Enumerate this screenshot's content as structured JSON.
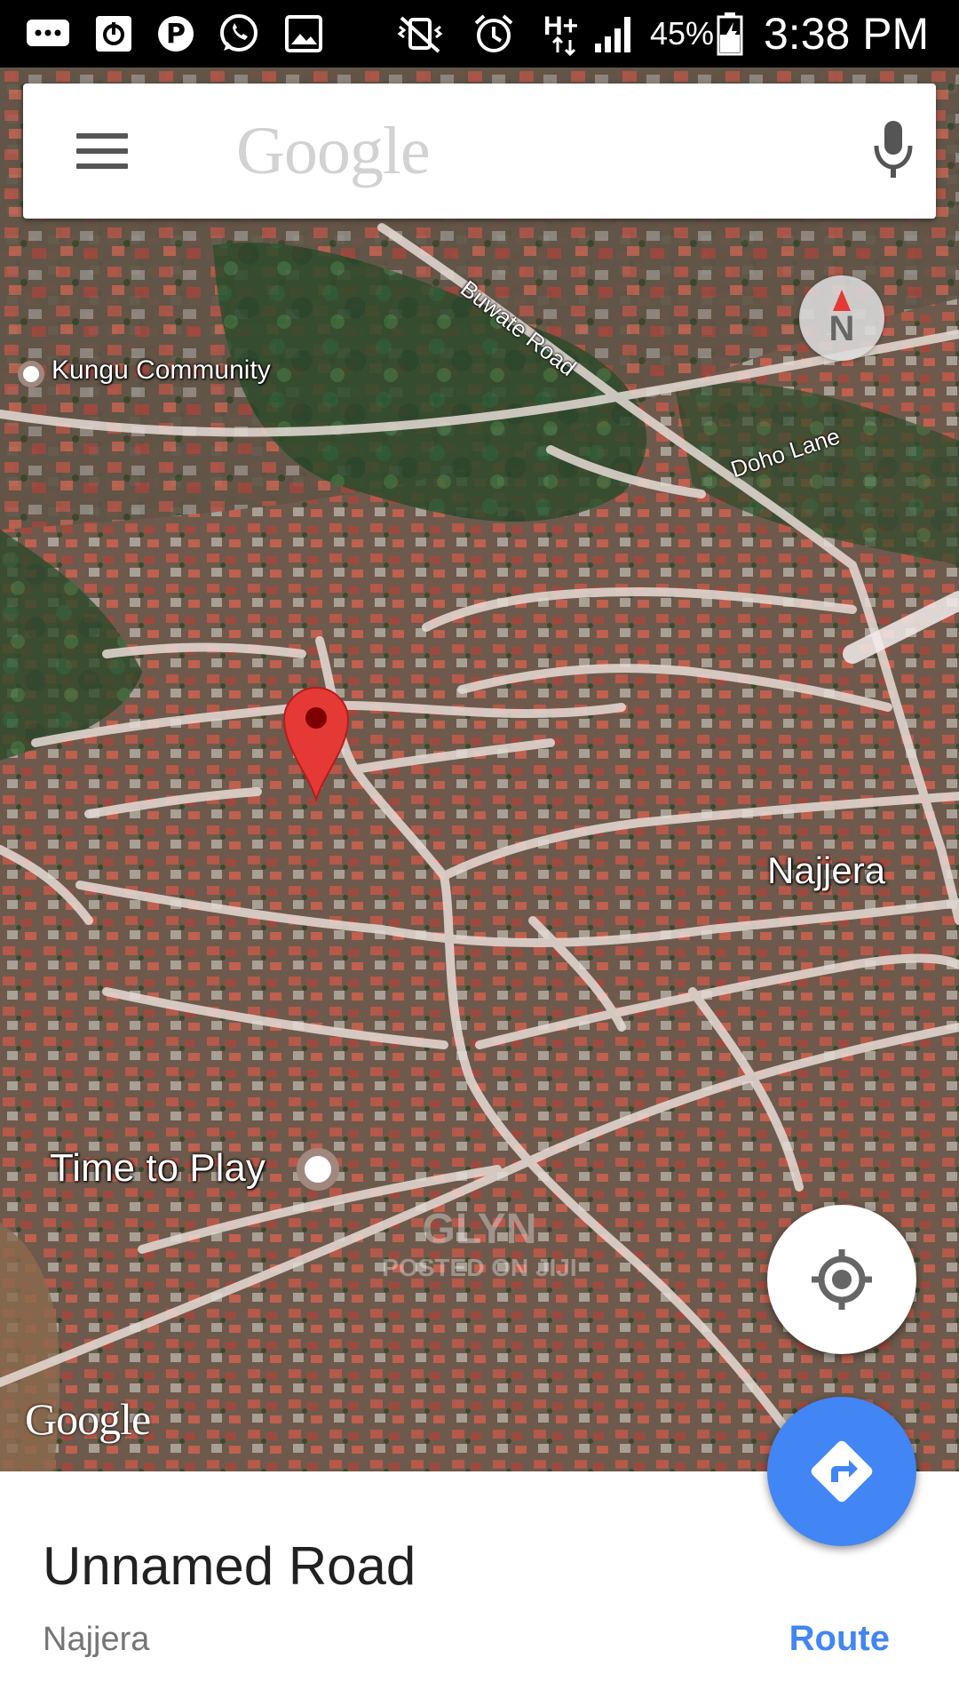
{
  "status_bar": {
    "battery": "45%",
    "time": "3:38 PM",
    "network": "H+",
    "icons": [
      "messages-icon",
      "power-icon",
      "pinterest-icon",
      "whatsapp-icon",
      "gallery-icon",
      "vibrate-off-icon",
      "alarm-icon",
      "network-icon",
      "signal-icon",
      "battery-icon"
    ]
  },
  "search": {
    "placeholder": "Google"
  },
  "compass": {
    "label": "N"
  },
  "map": {
    "places": {
      "kungu": "Kungu Community",
      "time_to_play": "Time to Play",
      "najjera": "Najjera"
    },
    "roads": {
      "buwate": "Buwate Road",
      "doho": "Doho Lane"
    },
    "watermark": {
      "line1": "GLYN",
      "line2": "POSTED ON JIJI"
    },
    "attribution": "Google"
  },
  "place_sheet": {
    "title": "Unnamed Road",
    "subtitle": "Najjera",
    "route_label": "Route"
  }
}
